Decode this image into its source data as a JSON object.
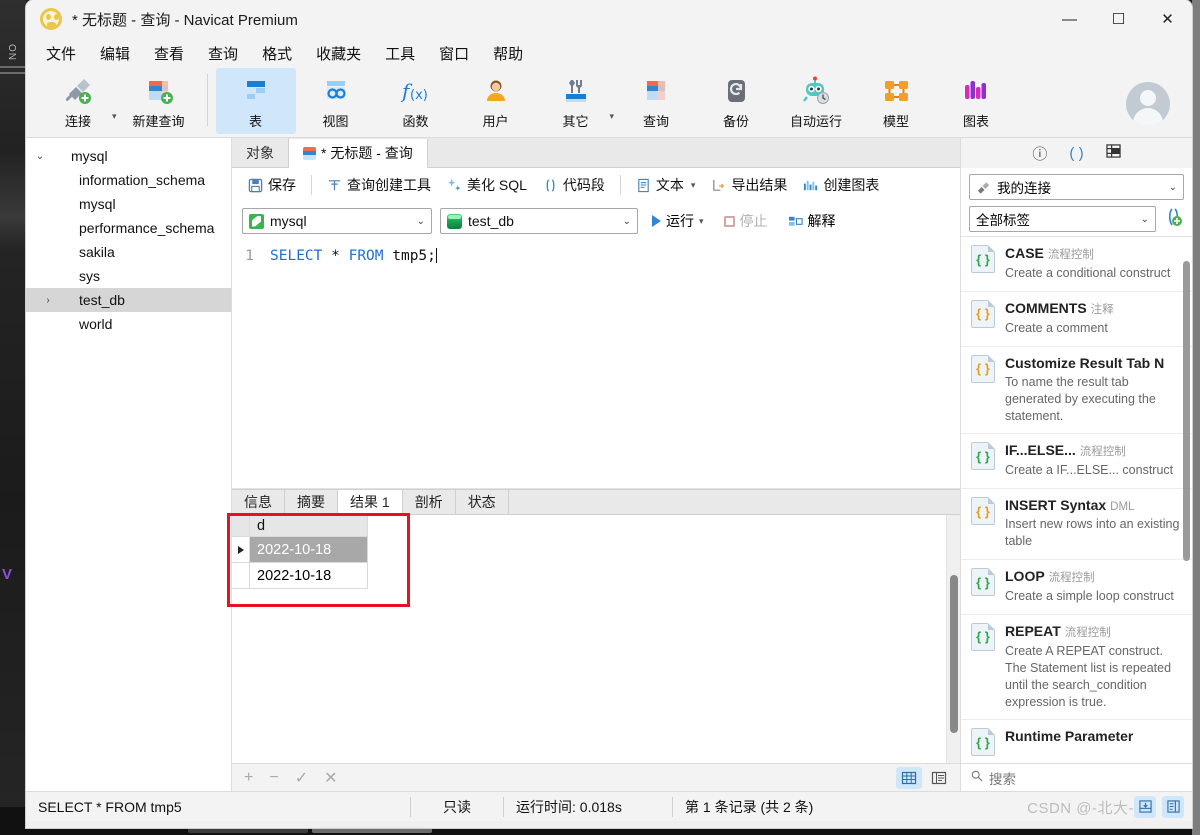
{
  "window": {
    "title": "* 无标题 - 查询 - Navicat Premium",
    "logo_icon": "navicat-paw-logo",
    "minimize": "—",
    "maximize": "☐",
    "close": "✕"
  },
  "menubar": {
    "items": [
      "文件",
      "编辑",
      "查看",
      "查询",
      "格式",
      "收藏夹",
      "工具",
      "窗口",
      "帮助"
    ]
  },
  "toolbar": {
    "items": [
      {
        "label": "连接",
        "icon": "connection-plug-icon",
        "has_caret": true,
        "active": false
      },
      {
        "label": "新建查询",
        "icon": "new-query-icon",
        "has_caret": false,
        "active": false
      },
      {
        "label": "表",
        "icon": "table-icon",
        "has_caret": false,
        "active": true
      },
      {
        "label": "视图",
        "icon": "view-icon",
        "has_caret": false,
        "active": false
      },
      {
        "label": "函数",
        "icon": "function-fx-icon",
        "has_caret": false,
        "active": false
      },
      {
        "label": "用户",
        "icon": "user-icon",
        "has_caret": false,
        "active": false
      },
      {
        "label": "其它",
        "icon": "other-tools-icon",
        "has_caret": true,
        "active": false
      },
      {
        "label": "查询",
        "icon": "query-icon",
        "has_caret": false,
        "active": false
      },
      {
        "label": "备份",
        "icon": "backup-icon",
        "has_caret": false,
        "active": false
      },
      {
        "label": "自动运行",
        "icon": "automation-robot-icon",
        "has_caret": false,
        "active": false
      },
      {
        "label": "模型",
        "icon": "model-icon",
        "has_caret": false,
        "active": false
      },
      {
        "label": "图表",
        "icon": "chart-icon",
        "has_caret": false,
        "active": false
      }
    ],
    "avatar_icon": "user-avatar"
  },
  "sidebar": {
    "items": [
      {
        "label": "mysql",
        "icon": "connection-icon",
        "indent": 0,
        "twisty": "expanded",
        "selected": false
      },
      {
        "label": "information_schema",
        "icon": "database-icon",
        "indent": 1,
        "twisty": "none",
        "selected": false
      },
      {
        "label": "mysql",
        "icon": "database-icon",
        "indent": 1,
        "twisty": "none",
        "selected": false
      },
      {
        "label": "performance_schema",
        "icon": "database-icon",
        "indent": 1,
        "twisty": "none",
        "selected": false
      },
      {
        "label": "sakila",
        "icon": "database-icon",
        "indent": 1,
        "twisty": "none",
        "selected": false
      },
      {
        "label": "sys",
        "icon": "database-icon",
        "indent": 1,
        "twisty": "none",
        "selected": false
      },
      {
        "label": "test_db",
        "icon": "database-active-icon",
        "indent": 1,
        "twisty": "collapsed",
        "selected": true
      },
      {
        "label": "world",
        "icon": "database-icon",
        "indent": 1,
        "twisty": "none",
        "selected": false
      }
    ]
  },
  "tabs": [
    {
      "label": "对象",
      "icon": "",
      "active": false
    },
    {
      "label": "* 无标题 - 查询",
      "icon": "query-tab-icon",
      "active": true
    }
  ],
  "query_toolbar": {
    "save": "保存",
    "query_builder": "查询创建工具",
    "beautify_sql": "美化 SQL",
    "snippets": "代码段",
    "text": "文本",
    "export_result": "导出结果",
    "create_chart": "创建图表"
  },
  "connection_row": {
    "connection": "mysql",
    "database": "test_db",
    "run": "运行",
    "stop": "停止",
    "explain": "解释"
  },
  "editor": {
    "line_number": "1",
    "keyword1": "SELECT",
    "star": " * ",
    "keyword2": "FROM",
    "rest": " tmp5;"
  },
  "result_tabs": [
    {
      "label": "信息",
      "active": false
    },
    {
      "label": "摘要",
      "active": false
    },
    {
      "label": "结果 1",
      "active": true
    },
    {
      "label": "剖析",
      "active": false
    },
    {
      "label": "状态",
      "active": false
    }
  ],
  "result_grid": {
    "columns": [
      "d"
    ],
    "rows": [
      {
        "values": [
          "2022-10-18"
        ],
        "selected": true
      },
      {
        "values": [
          "2022-10-18"
        ],
        "selected": false
      }
    ],
    "annotation_color": "#e81123"
  },
  "grid_footer": {
    "add": "+",
    "remove": "−",
    "confirm": "✓",
    "cancel": "✕",
    "grid_view_icon": "grid-view-icon",
    "form_view_icon": "form-view-icon"
  },
  "right_panel": {
    "icons": [
      "info-icon",
      "code-snippet-icon",
      "table-structure-icon"
    ],
    "connection_select": "我的连接",
    "connection_select_icon": "connection-plug-icon",
    "tag_select": "全部标签",
    "add_snippet_icon": "add-snippet-icon",
    "snippets": [
      {
        "title": "CASE",
        "tag": "流程控制",
        "desc": "Create a conditional construct",
        "icon_color": "green"
      },
      {
        "title": "COMMENTS",
        "tag": "注释",
        "desc": "Create a comment",
        "icon_color": "amber"
      },
      {
        "title": "Customize Result Tab N",
        "tag": "",
        "desc": "To name the result tab generated by executing the statement.",
        "icon_color": "amber"
      },
      {
        "title": "IF...ELSE...",
        "tag": "流程控制",
        "desc": "Create a IF...ELSE... construct",
        "icon_color": "green"
      },
      {
        "title": "INSERT Syntax",
        "tag": "DML",
        "desc": "Insert new rows into an existing table",
        "icon_color": "amber"
      },
      {
        "title": "LOOP",
        "tag": "流程控制",
        "desc": "Create a simple loop construct",
        "icon_color": "green"
      },
      {
        "title": "REPEAT",
        "tag": "流程控制",
        "desc": "Create A REPEAT construct. The Statement list is repeated until the search_condition expression is true.",
        "icon_color": "green"
      },
      {
        "title": "Runtime Parameter",
        "tag": "",
        "desc": "",
        "icon_color": "green"
      }
    ],
    "search_placeholder": "搜索",
    "search_icon": "search-icon"
  },
  "statusbar": {
    "sql": "SELECT * FROM tmp5",
    "readonly": "只读",
    "runtime": "运行时间: 0.018s",
    "record": "第 1 条记录 (共 2 条)",
    "watermark": "CSDN @-北大-"
  }
}
